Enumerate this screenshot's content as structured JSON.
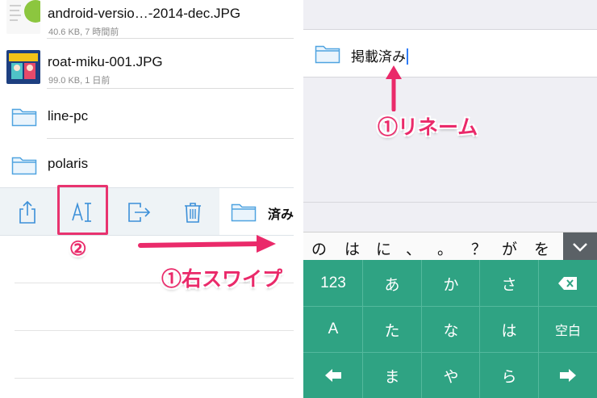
{
  "left_pane": {
    "files": [
      {
        "name": "android-versio…-2014-dec.JPG",
        "meta": "40.6 KB, 7 時間前",
        "type": "image",
        "thumb_icon": "android-thumbnail-icon"
      },
      {
        "name": "roat-miku-001.JPG",
        "meta": "99.0 KB, 1 日前",
        "type": "image",
        "thumb_icon": "miku-thumbnail-icon"
      },
      {
        "name": "line-pc",
        "type": "folder"
      },
      {
        "name": "polaris",
        "type": "folder"
      }
    ],
    "toolbar": {
      "actions": [
        "share-icon",
        "rename-icon",
        "move-icon",
        "trash-icon"
      ],
      "swiped_item_label": "済み"
    },
    "annotations": {
      "step2": "②",
      "swipe_right": "①右スワイプ"
    }
  },
  "right_pane": {
    "rename_field_value": "掲載済み",
    "annotation_rename": "①リネーム",
    "suggestions": [
      "の",
      "は",
      "に",
      "、",
      "。",
      "？",
      "が",
      "を"
    ],
    "keyboard": {
      "row1": [
        "123",
        "あ",
        "か",
        "さ",
        "⌫"
      ],
      "row2": [
        "A",
        "た",
        "な",
        "は",
        "空白"
      ],
      "row3": [
        "◀",
        "ま",
        "や",
        "ら",
        "▶"
      ]
    }
  },
  "colors": {
    "highlight_pink": "#e8336f",
    "keyboard_green": "#2fa383",
    "toolbar_icon_blue": "#3b8fd8",
    "folder_blue": "#4fa3e0"
  }
}
